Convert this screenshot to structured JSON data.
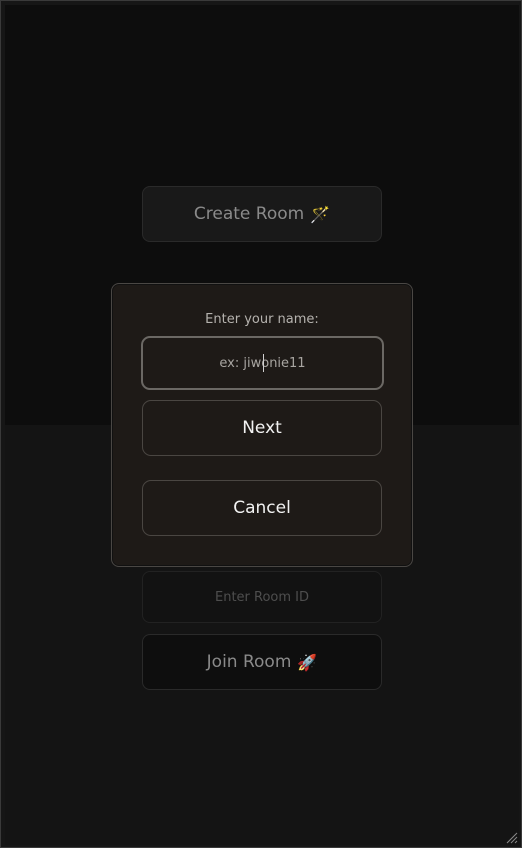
{
  "main": {
    "create_room_label": "Create Room",
    "create_room_icon": "wand-sparkles-icon",
    "create_room_emoji": "🪄",
    "room_id_placeholder": "Enter Room ID",
    "join_room_label": "Join Room",
    "join_room_icon": "rocket-icon",
    "join_room_emoji": "🚀"
  },
  "modal": {
    "label": "Enter your name:",
    "name_placeholder": "ex: jiwonie11",
    "next_label": "Next",
    "cancel_label": "Cancel"
  },
  "colors": {
    "modal_bg": "#1e1a17",
    "page_bg_top": "#0d0d0d",
    "page_bg_bottom": "#141414"
  }
}
